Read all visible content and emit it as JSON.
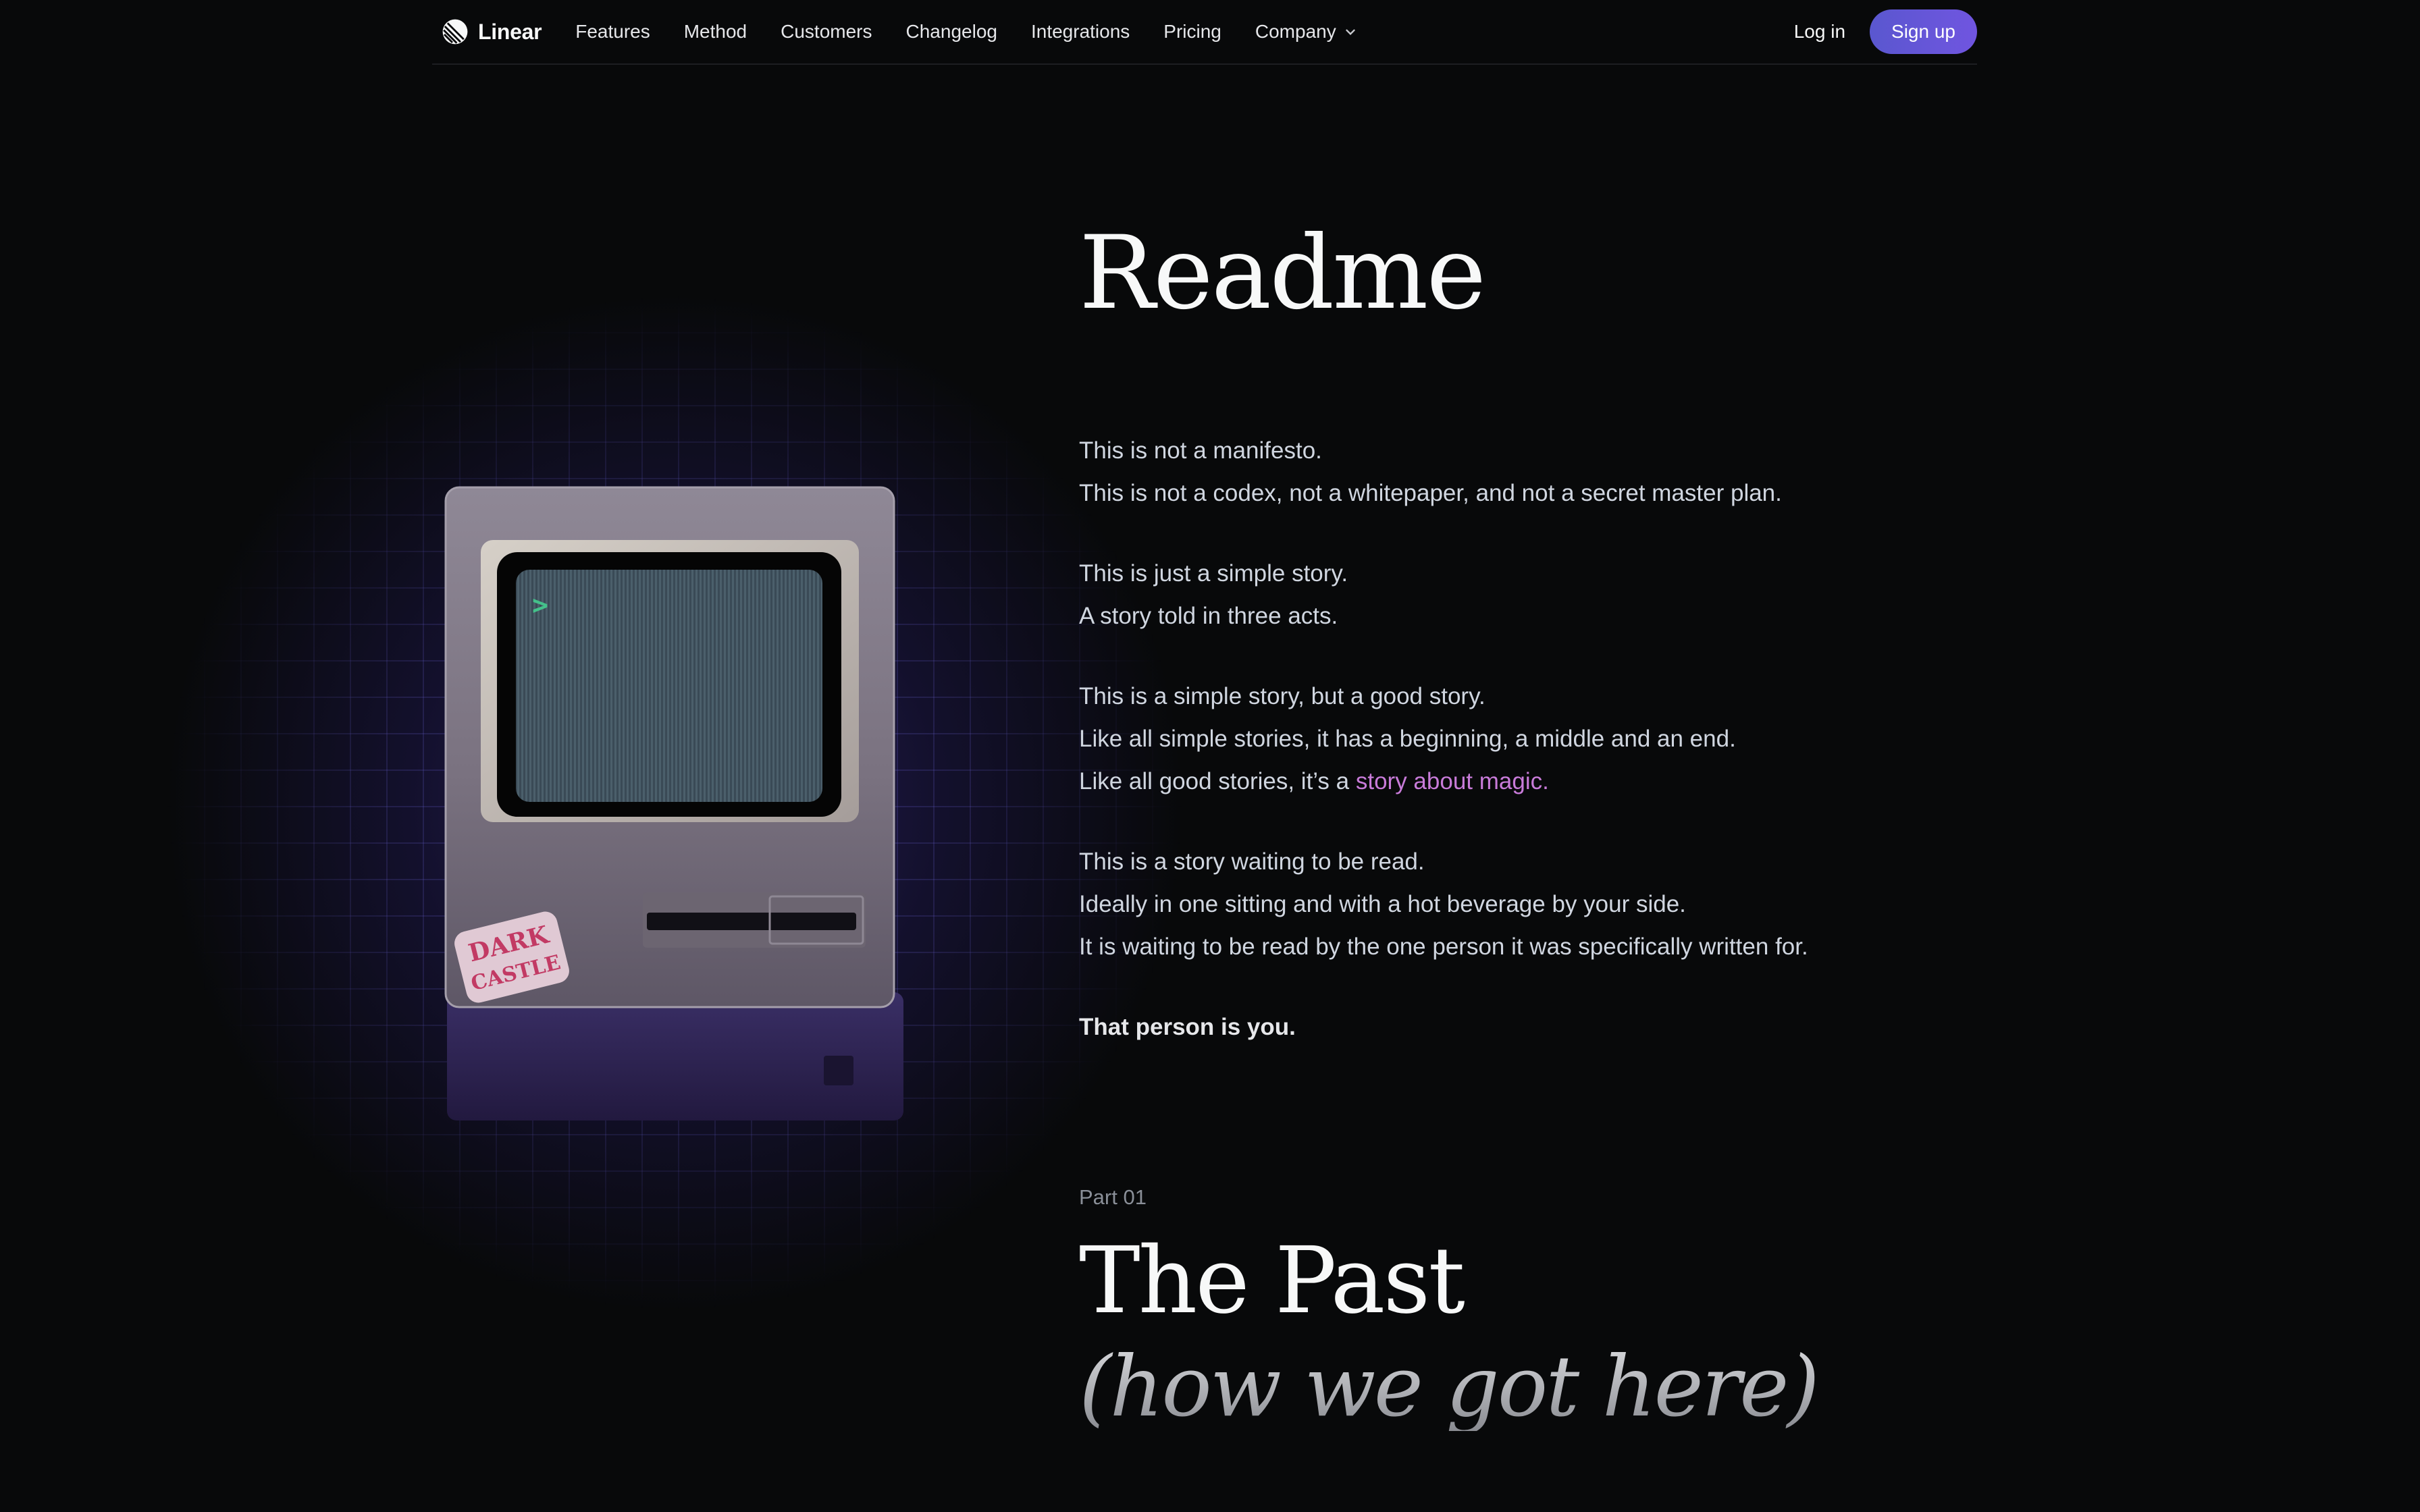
{
  "nav": {
    "logo_text": "Linear",
    "items": [
      {
        "label": "Features"
      },
      {
        "label": "Method"
      },
      {
        "label": "Customers"
      },
      {
        "label": "Changelog"
      },
      {
        "label": "Integrations"
      },
      {
        "label": "Pricing"
      },
      {
        "label": "Company"
      }
    ],
    "login_label": "Log in",
    "signup_label": "Sign up"
  },
  "illustration": {
    "prompt_glyph": ">",
    "sticker_line1": "DARK",
    "sticker_line2": "CASTLE"
  },
  "article": {
    "title": "Readme",
    "paragraphs": [
      [
        "This is not a manifesto.",
        "This is not a codex, not a whitepaper, and not a secret master plan."
      ],
      [
        "This is just a simple story.",
        "A story told in three acts."
      ],
      [
        "This is a simple story, but a good story.",
        "Like all simple stories, it has a beginning, a middle and an end."
      ],
      [
        "This is a story waiting to be read.",
        "Ideally in one sitting and with a hot beverage by your side.",
        "It is waiting to be read by the one person it was specifically written for."
      ]
    ],
    "magic_prefix": "Like all good stories, it’s a ",
    "magic_link": "story about magic.",
    "closing": "That person is you.",
    "part_label": "Part 01",
    "part_title": "The Past",
    "part_subtitle": "(how we got here)"
  },
  "colors": {
    "background": "#08090a",
    "accent": "#5e5ce0",
    "magic_link": "#c87bd9",
    "grid": "#6e64f0"
  }
}
